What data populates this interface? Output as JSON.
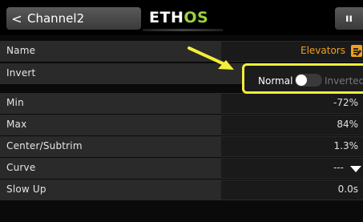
{
  "header": {
    "back_chevron": "<",
    "title": "Channel2",
    "logo_eth": "ETH",
    "logo_os": "OS",
    "right_label": "ıı"
  },
  "rows": [
    {
      "label": "Name",
      "value": "Elevators"
    },
    {
      "label": "Invert",
      "option_normal": "Normal",
      "option_inverted": "Inverted",
      "selected": "Normal"
    },
    {
      "label": "Min",
      "value": "-72%"
    },
    {
      "label": "Max",
      "value": "84%"
    },
    {
      "label": "Center/Subtrim",
      "value": "1.3%"
    },
    {
      "label": "Curve",
      "value": "---"
    },
    {
      "label": "Slow Up",
      "value": "0.0s"
    }
  ],
  "colors": {
    "accent_orange": "#f0a020",
    "highlight_yellow": "#f2ee3a",
    "logo_green": "#9bd43b"
  },
  "icons": {
    "back": "chevron-left-icon",
    "name_edit": "edit-icon",
    "curve_dropdown": "caret-down-icon",
    "annotation": "arrow-icon"
  }
}
